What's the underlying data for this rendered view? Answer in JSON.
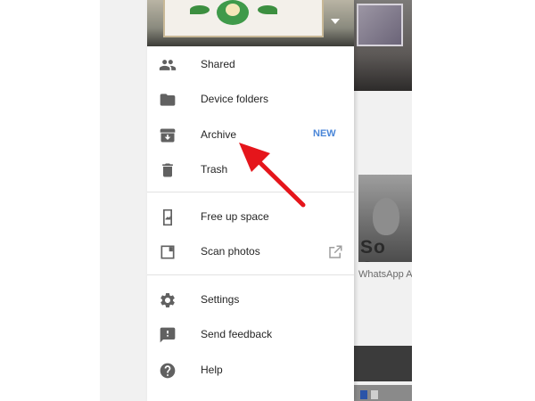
{
  "drawer": {
    "items_group_1": [
      {
        "label": "Shared",
        "icon": "people-icon"
      },
      {
        "label": "Device folders",
        "icon": "folder-icon"
      },
      {
        "label": "Archive",
        "icon": "archive-icon",
        "badge": "NEW"
      },
      {
        "label": "Trash",
        "icon": "trash-icon"
      }
    ],
    "items_group_2": [
      {
        "label": "Free up space",
        "icon": "phone-free-up-icon"
      },
      {
        "label": "Scan photos",
        "icon": "photo-scan-icon",
        "trailing_icon": "open-external-icon"
      }
    ],
    "items_group_3": [
      {
        "label": "Settings",
        "icon": "gear-icon"
      },
      {
        "label": "Send feedback",
        "icon": "feedback-icon"
      },
      {
        "label": "Help",
        "icon": "help-icon"
      }
    ]
  },
  "background": {
    "overlay_text": "So Co",
    "caption": "WhatsApp A"
  },
  "colors": {
    "badge": "#4a86d8",
    "annotation_arrow": "#e5151b",
    "icon": "#616161"
  }
}
